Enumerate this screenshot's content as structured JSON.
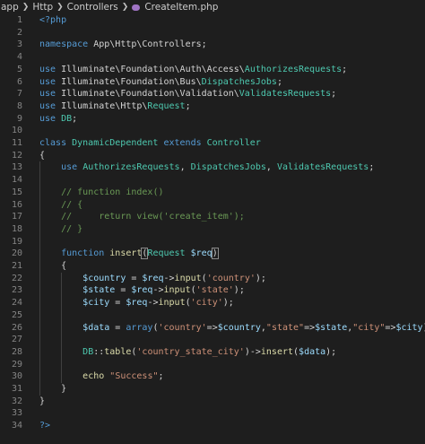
{
  "breadcrumb": {
    "items": [
      "app",
      "Http",
      "Controllers"
    ],
    "file": "CreateItem.php",
    "file_icon": "php-file-icon"
  },
  "editor": {
    "line_numbers": [
      "1",
      "2",
      "3",
      "4",
      "5",
      "6",
      "7",
      "8",
      "9",
      "10",
      "11",
      "12",
      "13",
      "14",
      "15",
      "16",
      "17",
      "18",
      "19",
      "20",
      "21",
      "22",
      "23",
      "24",
      "25",
      "26",
      "27",
      "28",
      "29",
      "30",
      "31",
      "32",
      "33",
      "34"
    ],
    "lines": [
      [
        [
          "tag",
          "<?php"
        ]
      ],
      [],
      [
        [
          "kw",
          "namespace "
        ],
        [
          "ns",
          "App\\Http\\Controllers"
        ],
        [
          "op",
          ";"
        ]
      ],
      [],
      [
        [
          "kw",
          "use "
        ],
        [
          "ns",
          "Illuminate\\Foundation\\Auth\\Access\\"
        ],
        [
          "cls",
          "AuthorizesRequests"
        ],
        [
          "op",
          ";"
        ]
      ],
      [
        [
          "kw",
          "use "
        ],
        [
          "ns",
          "Illuminate\\Foundation\\Bus\\"
        ],
        [
          "cls",
          "DispatchesJobs"
        ],
        [
          "op",
          ";"
        ]
      ],
      [
        [
          "kw",
          "use "
        ],
        [
          "ns",
          "Illuminate\\Foundation\\Validation\\"
        ],
        [
          "cls",
          "ValidatesRequests"
        ],
        [
          "op",
          ";"
        ]
      ],
      [
        [
          "kw",
          "use "
        ],
        [
          "ns",
          "Illuminate\\Http\\"
        ],
        [
          "cls",
          "Request"
        ],
        [
          "op",
          ";"
        ]
      ],
      [
        [
          "kw",
          "use "
        ],
        [
          "cls",
          "DB"
        ],
        [
          "op",
          ";"
        ]
      ],
      [],
      [
        [
          "kw",
          "class "
        ],
        [
          "cls",
          "DynamicDependent"
        ],
        [
          "kw",
          " extends "
        ],
        [
          "cls",
          "Controller"
        ]
      ],
      [
        [
          "op",
          "{"
        ]
      ],
      [
        [
          "op",
          "    "
        ],
        [
          "kw",
          "use "
        ],
        [
          "cls",
          "AuthorizesRequests"
        ],
        [
          "op",
          ", "
        ],
        [
          "cls",
          "DispatchesJobs"
        ],
        [
          "op",
          ", "
        ],
        [
          "cls",
          "ValidatesRequests"
        ],
        [
          "op",
          ";"
        ]
      ],
      [],
      [
        [
          "op",
          "    "
        ],
        [
          "com",
          "// function index()"
        ]
      ],
      [
        [
          "op",
          "    "
        ],
        [
          "com",
          "// {"
        ]
      ],
      [
        [
          "op",
          "    "
        ],
        [
          "com",
          "//     return view('create_item');"
        ]
      ],
      [
        [
          "op",
          "    "
        ],
        [
          "com",
          "// }"
        ]
      ],
      [],
      [
        [
          "op",
          "    "
        ],
        [
          "kw",
          "function "
        ],
        [
          "fn",
          "insert"
        ],
        [
          "brk",
          "("
        ],
        [
          "cls",
          "Request"
        ],
        [
          "op",
          " "
        ],
        [
          "var",
          "$req"
        ],
        [
          "brk",
          ")"
        ]
      ],
      [
        [
          "op",
          "    {"
        ]
      ],
      [
        [
          "op",
          "        "
        ],
        [
          "var",
          "$country"
        ],
        [
          "op",
          " = "
        ],
        [
          "var",
          "$req"
        ],
        [
          "op",
          "->"
        ],
        [
          "fn",
          "input"
        ],
        [
          "op",
          "("
        ],
        [
          "str",
          "'country'"
        ],
        [
          "op",
          ");"
        ]
      ],
      [
        [
          "op",
          "        "
        ],
        [
          "var",
          "$state"
        ],
        [
          "op",
          " = "
        ],
        [
          "var",
          "$req"
        ],
        [
          "op",
          "->"
        ],
        [
          "fn",
          "input"
        ],
        [
          "op",
          "("
        ],
        [
          "str",
          "'state'"
        ],
        [
          "op",
          ");"
        ]
      ],
      [
        [
          "op",
          "        "
        ],
        [
          "var",
          "$city"
        ],
        [
          "op",
          " = "
        ],
        [
          "var",
          "$req"
        ],
        [
          "op",
          "->"
        ],
        [
          "fn",
          "input"
        ],
        [
          "op",
          "("
        ],
        [
          "str",
          "'city'"
        ],
        [
          "op",
          ");"
        ]
      ],
      [],
      [
        [
          "op",
          "        "
        ],
        [
          "var",
          "$data"
        ],
        [
          "op",
          " = "
        ],
        [
          "kw",
          "array"
        ],
        [
          "op",
          "("
        ],
        [
          "str",
          "'country'"
        ],
        [
          "op",
          "=>"
        ],
        [
          "var",
          "$country"
        ],
        [
          "op",
          ","
        ],
        [
          "str",
          "\"state\""
        ],
        [
          "op",
          "=>"
        ],
        [
          "var",
          "$state"
        ],
        [
          "op",
          ","
        ],
        [
          "str",
          "\"city\""
        ],
        [
          "op",
          "=>"
        ],
        [
          "var",
          "$city"
        ],
        [
          "op",
          ");"
        ]
      ],
      [],
      [
        [
          "op",
          "        "
        ],
        [
          "cls",
          "DB"
        ],
        [
          "op",
          "::"
        ],
        [
          "fn",
          "table"
        ],
        [
          "op",
          "("
        ],
        [
          "str",
          "'country_state_city'"
        ],
        [
          "op",
          ")->"
        ],
        [
          "fn",
          "insert"
        ],
        [
          "op",
          "("
        ],
        [
          "var",
          "$data"
        ],
        [
          "op",
          ");"
        ]
      ],
      [],
      [
        [
          "op",
          "        "
        ],
        [
          "fn",
          "echo"
        ],
        [
          "op",
          " "
        ],
        [
          "str",
          "\"Success\""
        ],
        [
          "op",
          ";"
        ]
      ],
      [
        [
          "op",
          "    }"
        ]
      ],
      [
        [
          "op",
          "}"
        ]
      ],
      [],
      [
        [
          "tag",
          "?>"
        ]
      ]
    ]
  },
  "colors": {
    "background": "#1e1e1e",
    "keyword": "#569cd6",
    "class": "#4ec9b0",
    "variable": "#9cdcfe",
    "function": "#dcdcaa",
    "string": "#ce9178",
    "comment": "#6a9955"
  }
}
